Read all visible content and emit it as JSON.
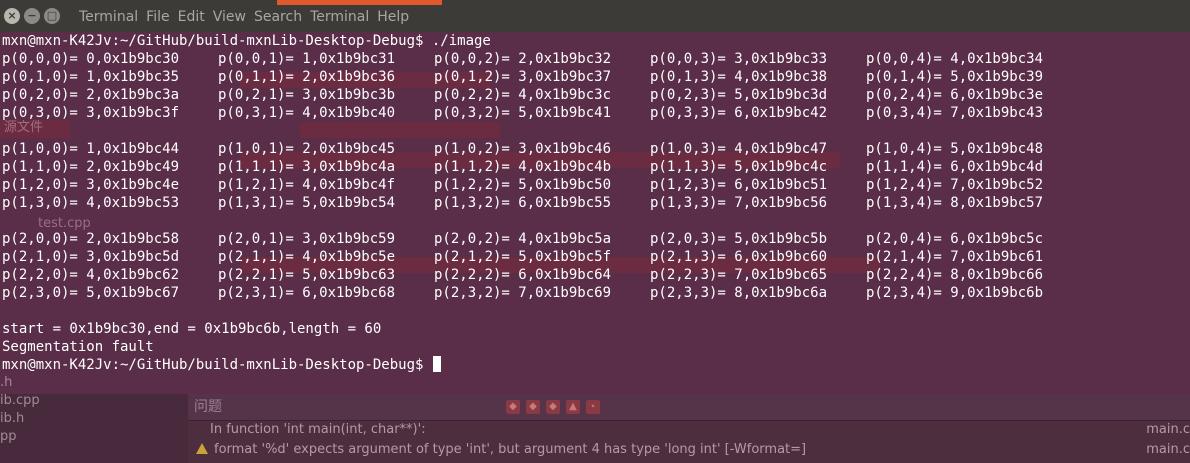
{
  "menu": [
    "Terminal",
    "File",
    "Edit",
    "View",
    "Search",
    "Terminal",
    "Help"
  ],
  "window_buttons": {
    "close": "×",
    "minimize": "−",
    "maximize": "□"
  },
  "terminal": {
    "prompt_cmd": "mxn@mxn-K42Jv:~/GitHub/build-mxnLib-Desktop-Debug$ ./image",
    "blocks": [
      [
        [
          "p(0,0,0)= 0,0x1b9bc30",
          "p(0,0,1)= 1,0x1b9bc31",
          "p(0,0,2)= 2,0x1b9bc32",
          "p(0,0,3)= 3,0x1b9bc33",
          "p(0,0,4)= 4,0x1b9bc34"
        ],
        [
          "p(0,1,0)= 1,0x1b9bc35",
          "p(0,1,1)= 2,0x1b9bc36",
          "p(0,1,2)= 3,0x1b9bc37",
          "p(0,1,3)= 4,0x1b9bc38",
          "p(0,1,4)= 5,0x1b9bc39"
        ],
        [
          "p(0,2,0)= 2,0x1b9bc3a",
          "p(0,2,1)= 3,0x1b9bc3b",
          "p(0,2,2)= 4,0x1b9bc3c",
          "p(0,2,3)= 5,0x1b9bc3d",
          "p(0,2,4)= 6,0x1b9bc3e"
        ],
        [
          "p(0,3,0)= 3,0x1b9bc3f",
          "p(0,3,1)= 4,0x1b9bc40",
          "p(0,3,2)= 5,0x1b9bc41",
          "p(0,3,3)= 6,0x1b9bc42",
          "p(0,3,4)= 7,0x1b9bc43"
        ]
      ],
      [
        [
          "p(1,0,0)= 1,0x1b9bc44",
          "p(1,0,1)= 2,0x1b9bc45",
          "p(1,0,2)= 3,0x1b9bc46",
          "p(1,0,3)= 4,0x1b9bc47",
          "p(1,0,4)= 5,0x1b9bc48"
        ],
        [
          "p(1,1,0)= 2,0x1b9bc49",
          "p(1,1,1)= 3,0x1b9bc4a",
          "p(1,1,2)= 4,0x1b9bc4b",
          "p(1,1,3)= 5,0x1b9bc4c",
          "p(1,1,4)= 6,0x1b9bc4d"
        ],
        [
          "p(1,2,0)= 3,0x1b9bc4e",
          "p(1,2,1)= 4,0x1b9bc4f",
          "p(1,2,2)= 5,0x1b9bc50",
          "p(1,2,3)= 6,0x1b9bc51",
          "p(1,2,4)= 7,0x1b9bc52"
        ],
        [
          "p(1,3,0)= 4,0x1b9bc53",
          "p(1,3,1)= 5,0x1b9bc54",
          "p(1,3,2)= 6,0x1b9bc55",
          "p(1,3,3)= 7,0x1b9bc56",
          "p(1,3,4)= 8,0x1b9bc57"
        ]
      ],
      [
        [
          "p(2,0,0)= 2,0x1b9bc58",
          "p(2,0,1)= 3,0x1b9bc59",
          "p(2,0,2)= 4,0x1b9bc5a",
          "p(2,0,3)= 5,0x1b9bc5b",
          "p(2,0,4)= 6,0x1b9bc5c"
        ],
        [
          "p(2,1,0)= 3,0x1b9bc5d",
          "p(2,1,1)= 4,0x1b9bc5e",
          "p(2,1,2)= 5,0x1b9bc5f",
          "p(2,1,3)= 6,0x1b9bc60",
          "p(2,1,4)= 7,0x1b9bc61"
        ],
        [
          "p(2,2,0)= 4,0x1b9bc62",
          "p(2,2,1)= 5,0x1b9bc63",
          "p(2,2,2)= 6,0x1b9bc64",
          "p(2,2,3)= 7,0x1b9bc65",
          "p(2,2,4)= 8,0x1b9bc66"
        ],
        [
          "p(2,3,0)= 5,0x1b9bc67",
          "p(2,3,1)= 6,0x1b9bc68",
          "p(2,3,2)= 7,0x1b9bc69",
          "p(2,3,3)= 8,0x1b9bc6a",
          "p(2,3,4)= 9,0x1b9bc6b"
        ]
      ]
    ],
    "summary": "start = 0x1b9bc30,end = 0x1b9bc6b,length = 60",
    "error": "Segmentation fault",
    "prompt": "mxn@mxn-K42Jv:~/GitHub/build-mxnLib-Desktop-Debug$ "
  },
  "ide_behind": {
    "sidebar_files": [
      "源文件",
      "test.cpp",
      ".h",
      "ib.cpp",
      "ib.h",
      "pp"
    ],
    "issues_title": "问题",
    "issues": [
      {
        "text": "In function 'int main(int, char**)':",
        "file": "main.c"
      },
      {
        "text": "format '%d' expects argument of type 'int', but argument 4 has type 'long int' [-Wformat=]",
        "file": "main.c"
      }
    ]
  },
  "colors": {
    "terminal_bg": "#5a2d48",
    "text": "#ffffff",
    "titlebar": "#3c3b37",
    "accent": "#e2582d"
  }
}
